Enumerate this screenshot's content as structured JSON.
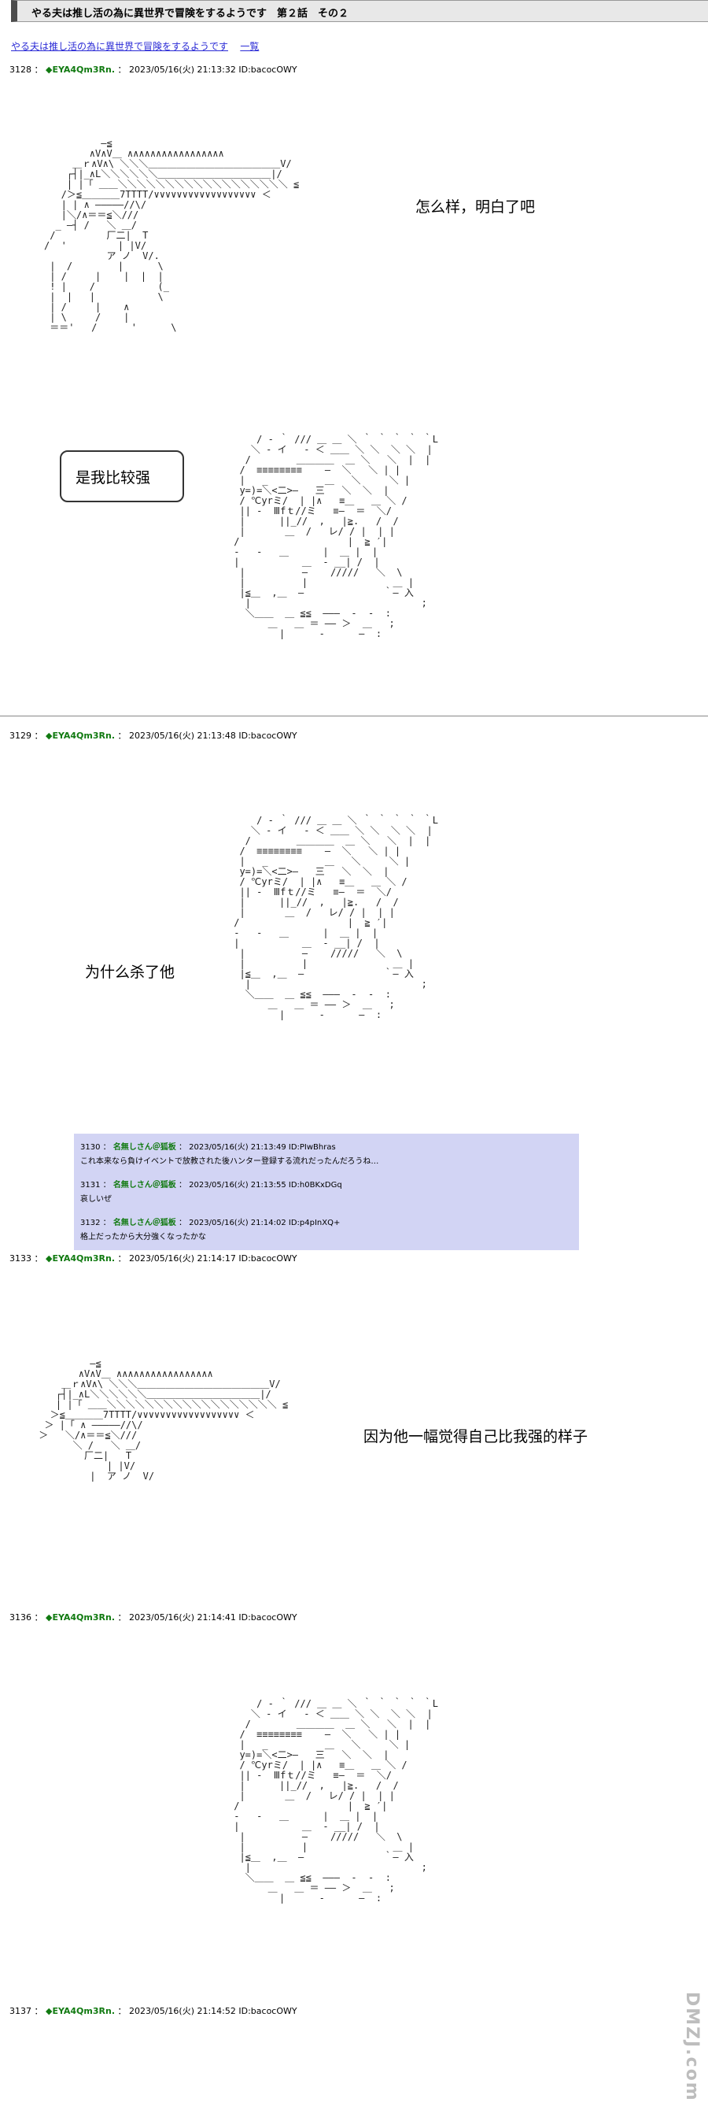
{
  "page_title": "やる夫は推し活の為に異世界で冒険をするようです　第２話　その２",
  "nav": {
    "link": "やる夫は推し活の為に異世界で冒険をするようです",
    "list": "一覧"
  },
  "posts": [
    {
      "num": "3128",
      "name": "◆EYA4Qm3Rn.",
      "meta": "2023/05/16(火) 21:13:32 ID:bacocOWY"
    },
    {
      "num": "3129",
      "name": "◆EYA4Qm3Rn.",
      "meta": "2023/05/16(火) 21:13:48 ID:bacocOWY"
    },
    {
      "num": "3133",
      "name": "◆EYA4Qm3Rn.",
      "meta": "2023/05/16(火) 21:14:17 ID:bacocOWY"
    },
    {
      "num": "3136",
      "name": "◆EYA4Qm3Rn.",
      "meta": "2023/05/16(火) 21:14:41 ID:bacocOWY"
    },
    {
      "num": "3137",
      "name": "◆EYA4Qm3Rn.",
      "meta": "2023/05/16(火) 21:14:52 ID:bacocOWY"
    }
  ],
  "captions": {
    "c1": "怎么样，明白了吧",
    "c2": "是我比较强",
    "c3": "为什么杀了他",
    "c4": "因为他一幅觉得自己比我强的样子"
  },
  "quotes": [
    {
      "num": "3130",
      "name": "名無しさん＠狐板",
      "meta": "2023/05/16(火) 21:13:49 ID:PIwBhras",
      "text": "これ本来なら負けイベントで放教された後ハンター登録する流れだったんだろうね…"
    },
    {
      "num": "3131",
      "name": "名無しさん＠狐板",
      "meta": "2023/05/16(火) 21:13:55 ID:h0BKxDGq",
      "text": "哀しいぜ"
    },
    {
      "num": "3132",
      "name": "名無しさん＠狐板",
      "meta": "2023/05/16(火) 21:14:02 ID:p4pInXQ+",
      "text": "格上だったから大分強くなったかな"
    }
  ],
  "art": {
    "a1": "          ―≦\n        ∧V∧V＿ ∧∧∧∧∧∧∧∧∧∧∧∧∧∧∧∧∧\n     ＿ｒ∧V∧\\ ＼＼＼＿＿＿＿＿＿＿＿＿＿＿＿＿＿V/\n    ┌┤|_∧L＼＼＼＼＼＼＿＿＿＿＿＿＿＿＿＿＿＿|/\n    | |「 ＿＿＼＼＼＼＼＼＼＼＼＼＼＼＼＼＼＼＼＼ ≦\n   /＞≦＿＿＿＿7TTTT/∨∨∨∨∨∨∨∨∨∨∨∨∨∨∨∨∨∨ ＜\n   | | ∧ ―――――//\\/\n   |＼/∧＝＝≦＼/// \n  _ ―┤ /   ＼ ＿/\n /         厂二|  T\n/  '         | |V/\n           ア ノ  V/.\n |  /        |      \\\n | /     |    |  |  |\n ! |    /           (_\n |  |   |           \\\n | /     |    ∧\n | \\     /    |\n ＝＝'   /      '      \\",
    "a2": "     / ‐ ｀ /// ＿ ＿ ＼ ｀ ｀ ｀ ｀ ｀L\n    ＼ ‐ イ   ‐ ＜ ＿＿ ＼ ＼  ＼ ＼  |\n   /        ＿＿＿＿  ＿ ＼   ＼  |  |\n  /  ≡≡≡≡≡≡≡≡    ―  ＼   ＼ | |\n  |   _          ＿   ＼     ＼ |\n  y=)=＼<二>―   三   ＼  ＼  |\n  / ℃yrミ/  | |∧   ≡＿   ＿ ＼ /\n  || ‐  Ⅲfｔ//ミ   ≡―  ＝  ＼/\n  |      ||_//  ,   |≧.   /  /\n  |       ＿  /   レ/ / |  | |\n /                   |  ≧ ′|\n -   -   ＿      |  ＿ |  |\n |           ＿  ‐ __| /  |\n  |          ―    /////   ＼  \\\n  |          |               ＿ |\n  |≦＿  ,＿  ―              ｀― 入\n   |                              ;\n   ＼＿＿  ＿ ≦≦  ―――  ‐  ‐  :\n       ＿   ＿ ＝ ―― ＞  ＿   ;\n         |      ‐      ―  :",
    "a3": "     / ‐ ｀ /// ＿ ＿ ＼ ｀ ｀ ｀ ｀ ｀L\n    ＼ ‐ イ   ‐ ＜ ＿＿ ＼ ＼  ＼ ＼  |\n   /        ＿＿＿＿  ＿ ＼   ＼  |  |\n  /  ≡≡≡≡≡≡≡≡    ―  ＼   ＼ | |\n  |   _          ＿   ＼     ＼ |\n  y=)=＼<二>―   三   ＼  ＼  |\n  / ℃yrミ/  | |∧   ≡＿   ＿ ＼ /\n  || ‐  Ⅲfｔ//ミ   ≡―  ＝  ＼/\n  |      ||_//  ,   |≧.   /  /\n  |       ＿  /   レ/ / |  | |\n /                   |  ≧ ′|\n -   -   ＿      |  ＿ |  |\n |           ＿  ‐ __| /  |\n  |          ―    /////   ＼  \\\n  |          |               ＿ |\n  |≦＿  ,＿  ―              ｀― 入\n   |                              ;\n   ＼＿＿  ＿ ≦≦  ―――  ‐  ‐  :\n       ＿   ＿ ＝ ―― ＞  ＿   ;\n         |      ‐      ―  :",
    "a4": "          ―≦\n        ∧V∧V＿ ∧∧∧∧∧∧∧∧∧∧∧∧∧∧∧∧∧\n     ＿ｒ∧V∧\\ ＼＼＼＿＿＿＿＿＿＿＿＿＿＿＿＿＿V/\n    ┌┤|_∧L＼＼＼＼＼＼＿＿＿＿＿＿＿＿＿＿＿＿|/\n    | |「 ＿＿＼＼＼＼＼＼＼＼＼＼＼＼＼＼＼＼＼＼ ≦\n   ＞≦＿＿＿＿7TTTT/∨∨∨∨∨∨∨∨∨∨∨∨∨∨∨∨∨∨ ＜\n  ＞ |「 ∧ ―――――//\\/\n ＞   ＼/∧＝＝≦＼/// \n       ＼ /   ＼ ＿/\n         厂二|   T\n             | |V/\n          |  ア ノ  V/",
    "a5": "     / ‐ ｀ /// ＿ ＿ ＼ ｀ ｀ ｀ ｀ ｀L\n    ＼ ‐ イ   ‐ ＜ ＿＿ ＼ ＼  ＼ ＼  |\n   /        ＿＿＿＿  ＿ ＼   ＼  |  |\n  /  ≡≡≡≡≡≡≡≡    ―  ＼   ＼ | |\n  |   _          ＿   ＼     ＼ |\n  y=)=＼<二>―   三   ＼  ＼  |\n  / ℃yrミ/  | |∧   ≡＿   ＿ ＼ /\n  || ‐  Ⅲfｔ//ミ   ≡―  ＝  ＼/\n  |      ||_//  ,   |≧.   /  /\n  |       ＿  /   レ/ / |  | |\n /                   |  ≧ ′|\n -   -   ＿      |  ＿ |  |\n |           ＿  ‐ __| /  |\n  |          ―    /////   ＼  \\\n  |          |               ＿ |\n  |≦＿  ,＿  ―              ｀― 入\n   |                              ;\n   ＼＿＿  ＿ ≦≦  ―――  ‐  ‐  :\n       ＿   ＿ ＝ ―― ＞  ＿   ;\n         |      ‐      ―  :"
  },
  "watermark": "DMZJ.com"
}
